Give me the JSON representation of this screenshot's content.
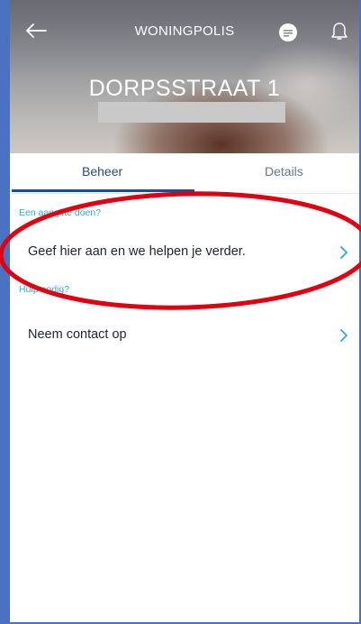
{
  "header": {
    "title": "WONINGPOLIS",
    "address": "DORPSSTRAAT 1"
  },
  "tabs": [
    {
      "label": "Beheer",
      "active": true
    },
    {
      "label": "Details",
      "active": false
    }
  ],
  "sections": [
    {
      "label": "Een aangifte doen?",
      "item": "Geef hier aan en we helpen je verder."
    },
    {
      "label": "Hulp nodig?",
      "item": "Neem contact op"
    }
  ],
  "colors": {
    "accent": "#30a9d6",
    "tab_indicator": "#1f4e8a",
    "annotation": "#e0000f",
    "frame": "#4a72c4"
  }
}
